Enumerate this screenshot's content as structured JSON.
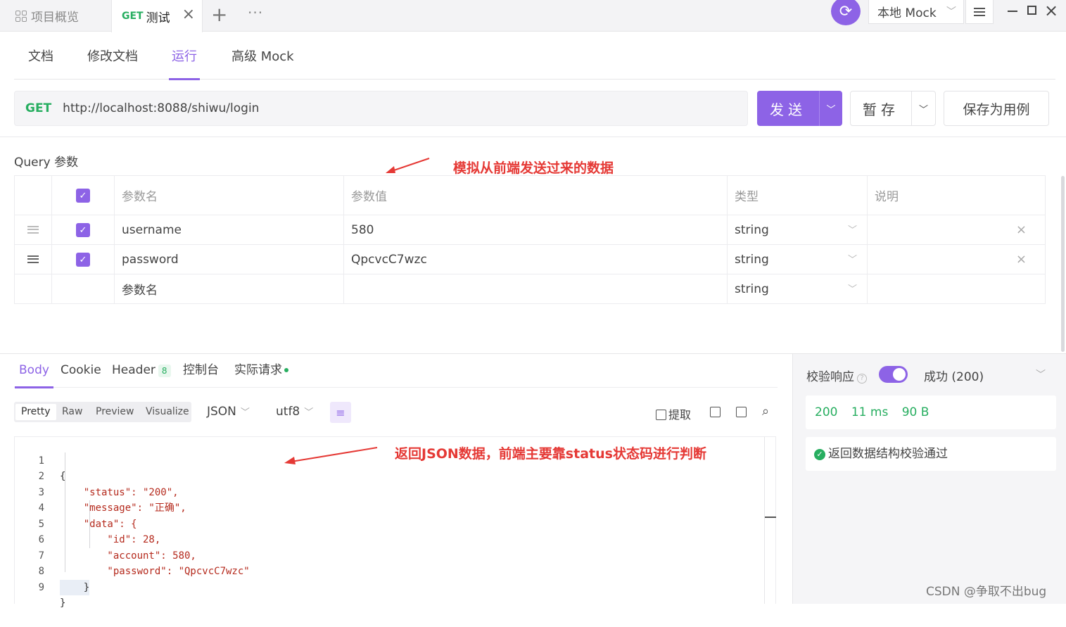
{
  "top_tabs": {
    "overview_label": "项目概览",
    "active_method": "GET",
    "active_name": "测试",
    "close_icon": "close-icon",
    "plus": "+",
    "more": "···",
    "mock_env": "本地 Mock"
  },
  "sub_tabs": [
    "文档",
    "修改文档",
    "运行",
    "高级 Mock"
  ],
  "request": {
    "method": "GET",
    "url": "http://localhost:8088/shiwu/login",
    "send_label": "发送",
    "save_label": "暂存",
    "save_case_label": "保存为用例"
  },
  "query": {
    "title": "Query 参数",
    "annotation": "模拟从前端发送过来的数据",
    "headers": [
      "参数名",
      "参数值",
      "类型",
      "说明"
    ],
    "rows": [
      {
        "name": "username",
        "value": "580",
        "type": "string"
      },
      {
        "name": "password",
        "value": "QpcvcC7wzc",
        "type": "string"
      }
    ],
    "new_row": {
      "name_placeholder": "参数名",
      "type": "string"
    }
  },
  "response": {
    "tabs": {
      "body": "Body",
      "cookie": "Cookie",
      "header": "Header",
      "header_count": "8",
      "console": "控制台",
      "actual": "实际请求"
    },
    "views": [
      "Pretty",
      "Raw",
      "Preview",
      "Visualize"
    ],
    "format": "JSON",
    "encoding": "utf8",
    "extract_label": "提取",
    "annotation": "返回JSON数据，前端主要靠status状态码进行判断",
    "code": [
      "{",
      "    \"status\": \"200\",",
      "    \"message\": \"正确\",",
      "    \"data\": {",
      "        \"id\": 28,",
      "        \"account\": 580,",
      "        \"password\": \"QpcvcC7wzc\"",
      "    }",
      "}"
    ],
    "line_numbers": [
      "1",
      "2",
      "3",
      "4",
      "5",
      "6",
      "7",
      "8",
      "9"
    ]
  },
  "verify": {
    "title": "校验响应",
    "status": "成功 (200)",
    "code": "200",
    "time": "11 ms",
    "size": "90 B",
    "result": "返回数据结构校验通过",
    "toggle_on": true
  },
  "watermark": "CSDN @争取不出bug",
  "colors": {
    "accent": "#8d63e6",
    "get": "#27ae60",
    "annotation": "#e53935"
  }
}
